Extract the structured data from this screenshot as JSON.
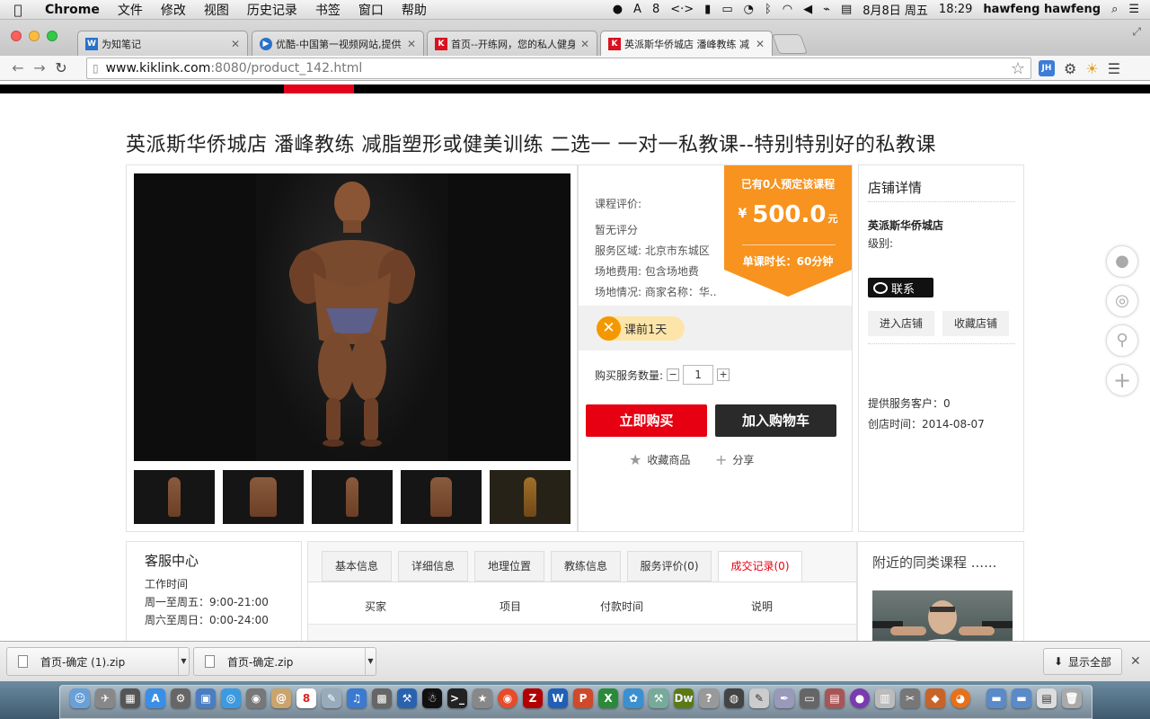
{
  "menubar": {
    "app": "Chrome",
    "items": [
      "文件",
      "修改",
      "视图",
      "历史记录",
      "书签",
      "窗口",
      "帮助"
    ],
    "status_input": "8",
    "date": "8月8日 周五",
    "time": "18:29",
    "user": "hawfeng hawfeng"
  },
  "tabs": [
    {
      "label": "为知笔记",
      "favicon": "W",
      "color": "#2a72c9"
    },
    {
      "label": "优酷-中国第一视频网站,提供",
      "favicon": "▶",
      "color": "#2a72c9"
    },
    {
      "label": "首页--开练网，您的私人健身",
      "favicon": "K",
      "color": "#d8121f"
    },
    {
      "label": "英派斯华侨城店 潘峰教练 减",
      "favicon": "K",
      "color": "#d8121f"
    }
  ],
  "url": {
    "host": "www.kiklink.com",
    "rest": ":8080/product_142.html"
  },
  "toolbar": {
    "ext_label": "JH"
  },
  "product": {
    "title": "英派斯华侨城店 潘峰教练 减脂塑形或健美训练 二选一 一对一私教课--特别特别好的私教课",
    "rating_label": "课程评价:",
    "no_rating": "暂无评分",
    "area_label": "服务区域:",
    "area_value": "北京市东城区",
    "fee_label": "场地费用:",
    "fee_value": "包含场地费",
    "venue_label": "场地情况:",
    "venue_value": "商家名称：华..",
    "booked_text": "已有0人预定该课程",
    "currency": "¥",
    "price": "500.0",
    "price_unit": "元",
    "duration": "单课时长：60分钟",
    "notice_pill": "课前1天",
    "notice_icon": "✕",
    "qty_label": "购买服务数量:",
    "qty_minus": "−",
    "qty_value": "1",
    "qty_plus": "+",
    "buy_now": "立即购买",
    "add_cart": "加入购物车",
    "favorite": "收藏商品",
    "share": "分享"
  },
  "shop": {
    "heading": "店铺详情",
    "name": "英派斯华侨城店",
    "level_label": "级别:",
    "contact": "联系",
    "enter_shop": "进入店铺",
    "fav_shop": "收藏店铺",
    "served": "提供服务客户：0",
    "opened": "创店时间：2014-08-07"
  },
  "service": {
    "heading": "客服中心",
    "hours_label": "工作时间",
    "weekday": "周一至周五：9:00-21:00",
    "weekend": "周六至周日：0:00-24:00"
  },
  "detail_tabs": [
    "基本信息",
    "详细信息",
    "地理位置",
    "教练信息",
    "服务评价(0)",
    "成交记录(0)"
  ],
  "records_columns": [
    "买家",
    "项目",
    "付款时间",
    "说明"
  ],
  "nearby": {
    "heading": "附近的同类课程 ......"
  },
  "downloads": {
    "items": [
      "首页-确定 (1).zip",
      "首页-确定.zip"
    ],
    "show_all": "显示全部"
  },
  "colors": {
    "accent_red": "#e60012",
    "badge_orange": "#f7931e",
    "dark_button": "#2a2a2a"
  }
}
